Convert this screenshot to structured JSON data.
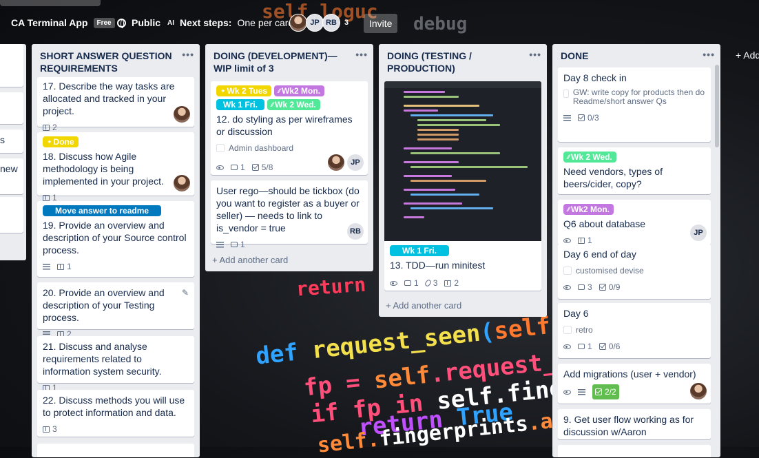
{
  "header": {
    "board_title": "CA Terminal App",
    "plan_badge": "Free",
    "visibility": "Public",
    "ai_icon": "AI",
    "next_steps_label": "Next steps:",
    "next_steps_value": "One per card",
    "members": [
      "JP",
      "RB"
    ],
    "member_overflow": "3",
    "invite_label": "Invite"
  },
  "lists": {
    "leftpartial": {
      "fragments": [
        ")",
        "s",
        "new"
      ]
    },
    "shortanswer": {
      "title": "SHORT ANSWER QUESTION REQUIREMENTS",
      "cards": [
        {
          "title": "17. Describe the way tasks are allocated and tracked in your project.",
          "attachments": "2"
        },
        {
          "label": "Done",
          "title": "18. Discuss how Agile methodology is being implemented in your project.",
          "attachments": "1"
        },
        {
          "label": "Move answer to readme",
          "title": "19. Provide an overview and description of your Source control process.",
          "attachments": "1"
        },
        {
          "title": "20. Provide an overview and description of your Testing process.",
          "attachments": "2"
        },
        {
          "title": "21. Discuss and analyse requirements related to information system security.",
          "attachments": "1"
        },
        {
          "title": "22. Discuss methods you will use to protect information and data.",
          "attachments": "3"
        }
      ]
    },
    "doing": {
      "title": "DOING (DEVELOPMENT)—WIP limit of 3",
      "cards": [
        {
          "labels": [
            "Wk 2 Tues",
            "Wk2 Mon.",
            "Wk 1 Fri.",
            "Wk 2 Wed."
          ],
          "title": "12. do styling as per wireframes or discussion",
          "checklist_item": "Admin dashboard",
          "comments": "1",
          "checklist": "5/8",
          "member": "JP"
        },
        {
          "title": "User rego—should be tickbox (do you want to register as a buyer or seller) — needs to link to is_vendor = true",
          "comments": "1",
          "member": "RB"
        }
      ],
      "add_card": "+ Add another card"
    },
    "testing": {
      "title": "DOING (TESTING / PRODUCTION)",
      "cards": [
        {
          "label": "Wk 1 Fri.",
          "title": "13. TDD—run minitest",
          "comments": "1",
          "attachments_clip": "3",
          "attachments": "2"
        }
      ],
      "add_card": "+ Add another card"
    },
    "done": {
      "title": "DONE",
      "cards": [
        {
          "title": "Day 8 check in",
          "checklist_item": "GW: write copy for products then do Readme/short answer Qs",
          "checklist": "0/3"
        },
        {
          "label": "Wk 2 Wed.",
          "title": "Need vendors, types of beers/cider, copy?"
        },
        {
          "label": "Wk2 Mon.",
          "title": "Q6 about database",
          "attachments": "1",
          "member": "JP"
        },
        {
          "title": "Day 6 end of day",
          "checklist_item": "customised devise",
          "comments": "3",
          "checklist": "0/9"
        },
        {
          "title": "Day 6",
          "checklist_item": "retro",
          "comments": "1",
          "checklist": "0/6"
        },
        {
          "title": "Add migrations (user + vendor)",
          "checklist": "2/2"
        },
        {
          "title": "9. Get user flow working as for discussion w/Aaron"
        }
      ]
    }
  },
  "add_list": "+ Add",
  "colors": {
    "label_yellow": "#f2d600",
    "label_purple": "#c377e0",
    "label_sky": "#00c2e0",
    "label_green": "#51e898",
    "label_blue": "#0079bf",
    "list_bg": "#ebecf0"
  }
}
